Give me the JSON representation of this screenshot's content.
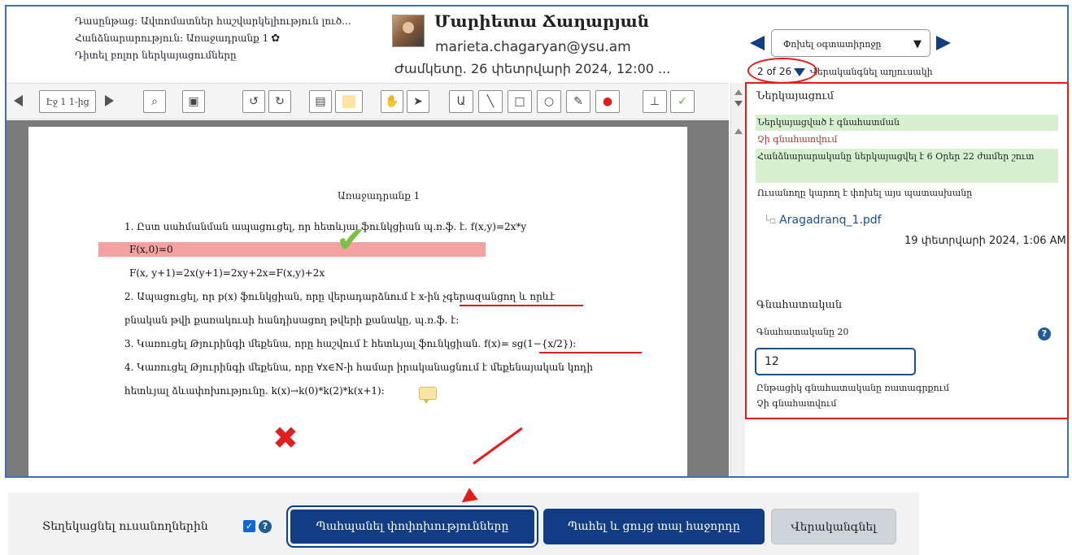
{
  "header": {
    "assignment_line": "Դասընթաց: Ավտոմատներ հաշվարկելիություն լուծ...",
    "assignment_name": "Հանձնարարություն: Առաջադրանք 1",
    "view_all": "Դիտել բոլոր ներկայացումները",
    "user_name": "Մարիետա Ճաղարյան",
    "user_email": "marieta.chagaryan@ysu.am",
    "due_date": "Ժամկետը. 26 փետրվարի 2024, 12:00 ..."
  },
  "nav": {
    "user_select": "Փոխել օգտատիրոջը",
    "pager": "2 of 26",
    "reset_table": "Վերականգնել աղյուսակի"
  },
  "toolbar": {
    "page_label": "Էջ 1 1-ից"
  },
  "document": {
    "title": "Առաջադրանք 1",
    "line1": "1. Ըստ սահմանման ապացուցել, որ հետևյալ ֆունկցիան պ.ռ.ֆ. է.    f(x,y)=2x*y",
    "line2": "F(x,0)=0",
    "line3": "F(x, y+1)=2x(y+1)=2xy+2x=F(x,y)+2x",
    "line4": "2. Ապացուցել, որ p(x) ֆունկցիան, որը վերադարձնում է x-ին չգերազանցող և որևէ",
    "line5": "բնական թվի քառակուսի հանդիսացող թվերի քանակը, պ.ռ.ֆ. է:",
    "line6": "3. Կառուցել Թյուրինգի մեքենա, որը հաշվում է հետևյալ ֆունկցիան.    f(x)= sg(1−{x/2}):",
    "line7": "4. Կառուցել Թյուրինգի մեքենա, որը ∀x∈N-ի համար իրականացնում է մեքենայական կոդի",
    "line8": "հետևյալ ձևափոխությունը.   k(x)→k(0)*k(2)*k(x+1):"
  },
  "panel": {
    "submission_title": "Ներկայացում",
    "submitted_for_grading": "Ներկայացված է գնահատման",
    "not_graded": "Չի գնահատվում",
    "submitted_early": "Հանձնարարականը ներկայացվել է 6 Օրեր 22 ժամեր շուտ",
    "student_can_edit": "Ուսանողը կարող է փոխել այս պատասխանը",
    "file_name": "Aragadranq_1.pdf",
    "file_date": "19 փետրվարի 2024, 1:06 AM",
    "grade_heading": "Գնահատական",
    "grade_label": "Գնահատականը 20",
    "grade_value": "12",
    "current_grade_label": "Ընթացիկ գնահատականը ռատագրքում",
    "current_grade_value": "Չի գնահատվում"
  },
  "footer": {
    "notify_label": "Տեղեկացնել ուսանողներին",
    "save_changes": "Պահպանել փոփոխությունները",
    "save_and_next": "Պահել և ցույց տալ հաջորդը",
    "reset": "Վերականգնել"
  },
  "colors": {
    "primary": "#123d84",
    "annotation_red": "#e31b1b",
    "highlight_green": "#d7f0cf",
    "highlight_pink": "#f4a1a1"
  }
}
